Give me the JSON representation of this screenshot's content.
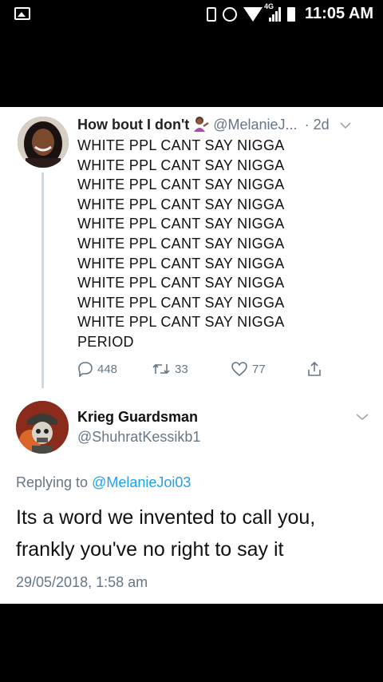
{
  "status_bar": {
    "time": "11:05 AM",
    "network": "4G",
    "icons": [
      "gallery-icon",
      "vibrate-icon",
      "alarm-icon",
      "wifi-icon",
      "signal-icon",
      "battery-icon"
    ]
  },
  "tweet": {
    "display_name": "How bout I don't",
    "emoji": "woman-tipping-hand-emoji",
    "handle": "@MelanieJ...",
    "age": "· 2d",
    "lines": [
      "WHITE PPL CANT SAY NIGGA",
      "WHITE PPL CANT SAY NIGGA",
      "WHITE PPL CANT SAY NIGGA",
      "WHITE PPL CANT SAY NIGGA",
      "WHITE PPL CANT SAY NIGGA",
      "WHITE PPL CANT SAY NIGGA",
      "WHITE PPL CANT SAY NIGGA",
      "WHITE PPL CANT SAY NIGGA",
      "WHITE PPL CANT SAY NIGGA",
      "WHITE PPL CANT SAY NIGGA",
      "PERIOD"
    ],
    "replies": "448",
    "retweets": "33",
    "likes": "77"
  },
  "reply_tweet": {
    "display_name": "Krieg Guardsman",
    "handle": "@ShuhratKessikb1",
    "replying_to_label": "Replying to",
    "replying_to_handle": "@MelanieJoi03",
    "text_line1": "Its a word we invented to call you,",
    "text_line2": "frankly you've no right to say it",
    "timestamp": "29/05/2018, 1:58 am"
  },
  "colors": {
    "background": "#000000",
    "card": "#ffffff",
    "secondary_text": "#657786",
    "link": "#1da1f2",
    "thread_line": "#cfd9de"
  }
}
